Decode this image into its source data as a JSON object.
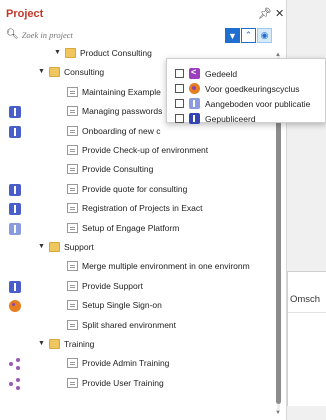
{
  "header": {
    "title": "Project",
    "pin_icon": "pin-icon",
    "close_icon": "close-icon"
  },
  "search": {
    "placeholder": "Zoek in project",
    "icon": "search-icon"
  },
  "toolbar": {
    "filter_icon": "filter-icon",
    "collapse_icon": "chevron-up-icon",
    "eye_icon": "eye-icon"
  },
  "tree": [
    {
      "label": "Product Consulting",
      "type": "folder",
      "expanded": true,
      "status": null
    },
    {
      "label": "Consulting",
      "type": "folder",
      "expanded": true,
      "status": null
    },
    {
      "label": "Maintaining Example",
      "type": "doc",
      "status": null
    },
    {
      "label": "Managing passwords",
      "type": "doc",
      "status": "book"
    },
    {
      "label": "Onboarding of new c",
      "type": "doc",
      "status": "book"
    },
    {
      "label": "Provide Check-up of environment",
      "type": "doc",
      "status": null
    },
    {
      "label": "Provide Consulting",
      "type": "doc",
      "status": null
    },
    {
      "label": "Provide quote for consulting",
      "type": "doc",
      "status": "book"
    },
    {
      "label": "Registration of Projects in Exact",
      "type": "doc",
      "status": "book"
    },
    {
      "label": "Setup of Engage Platform",
      "type": "doc",
      "status": "book-light"
    },
    {
      "label": "Support",
      "type": "folder",
      "expanded": true,
      "status": null
    },
    {
      "label": "Merge multiple environment in one environm",
      "type": "doc",
      "status": null
    },
    {
      "label": "Provide Support",
      "type": "doc",
      "status": "book"
    },
    {
      "label": "Setup Single Sign-on",
      "type": "doc",
      "status": "cookie"
    },
    {
      "label": "Split shared environment",
      "type": "doc",
      "status": null
    },
    {
      "label": "Training",
      "type": "folder",
      "expanded": true,
      "status": null
    },
    {
      "label": "Provide Admin Training",
      "type": "doc",
      "status": "share"
    },
    {
      "label": "Provide User Training",
      "type": "doc",
      "status": "share"
    }
  ],
  "filter_popup": {
    "options": [
      {
        "label": "Gedeeld",
        "icon": "share-icon",
        "checked": false
      },
      {
        "label": "Voor goedkeuringscyclus",
        "icon": "cookie-icon",
        "checked": false
      },
      {
        "label": "Aangeboden voor publicatie",
        "icon": "book-light-icon",
        "checked": false
      },
      {
        "label": "Gepubliceerd",
        "icon": "book-icon",
        "checked": false
      }
    ]
  },
  "right_panel": {
    "label": "Omsch"
  },
  "colors": {
    "title": "#c0392b",
    "accent": "#1e6fd0",
    "folder": "#f0c75e",
    "published": "#3345b3",
    "shared": "#9b3fbf",
    "approval": "#e67e22"
  }
}
